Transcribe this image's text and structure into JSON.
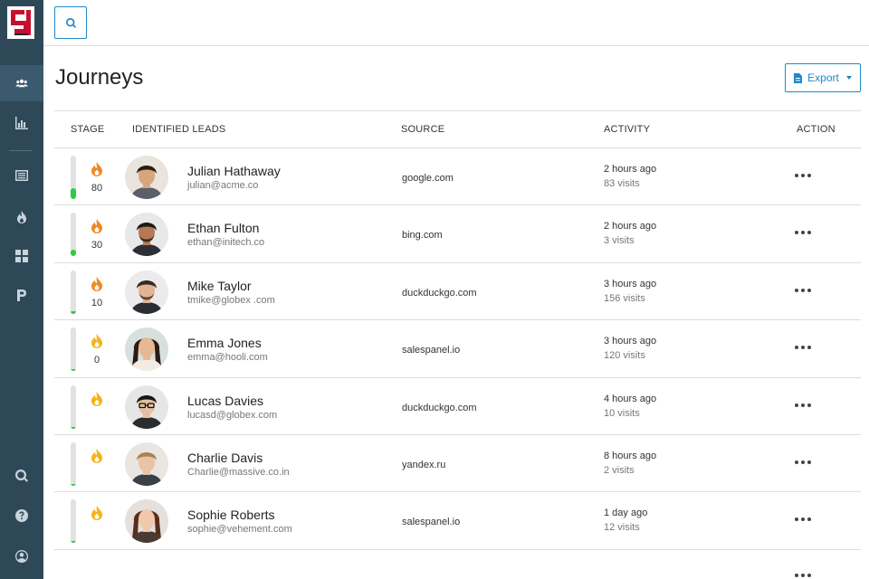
{
  "app": {
    "logo": "salespanel-logo",
    "accent": "#1e88c8",
    "sidebar_bg": "#2f4858"
  },
  "sidebar": {
    "top_items": [
      {
        "icon": "users-icon",
        "active": true
      },
      {
        "icon": "chart-icon",
        "active": false
      },
      {
        "icon": "list-icon",
        "active": false
      },
      {
        "icon": "fire-icon",
        "active": false
      },
      {
        "icon": "grid-icon",
        "active": false
      },
      {
        "icon": "p-icon",
        "active": false
      }
    ],
    "bottom_items": [
      {
        "icon": "search-icon"
      },
      {
        "icon": "help-icon"
      },
      {
        "icon": "account-icon"
      }
    ]
  },
  "topbar": {
    "search_icon": "search-icon"
  },
  "page": {
    "title": "Journeys",
    "export_label": "Export",
    "export_icon": "file-icon"
  },
  "table": {
    "columns": [
      "STAGE",
      "IDENTIFIED LEADS",
      "SOURCE",
      "ACTIVITY",
      "ACTION"
    ],
    "rows": [
      {
        "score": "80",
        "stage_fill": 0.25,
        "flame_color": "#f08a24",
        "name": "Julian Hathaway",
        "email": "julian@acme.co",
        "source": "google.com",
        "time": "2 hours ago",
        "visits": "83 visits",
        "avatar_bg": "#e9e4dc"
      },
      {
        "score": "30",
        "stage_fill": 0.15,
        "flame_color": "#f08a24",
        "name": "Ethan Fulton",
        "email": "ethan@initech.co",
        "source": "bing.com",
        "time": "2 hours ago",
        "visits": "3 visits",
        "avatar_bg": "#e8e8e8"
      },
      {
        "score": "10",
        "stage_fill": 0.06,
        "flame_color": "#f08a24",
        "name": "Mike Taylor",
        "email": "tmike@globex .com",
        "source": "duckduckgo.com",
        "time": "3 hours ago",
        "visits": "156 visits",
        "avatar_bg": "#ebebeb"
      },
      {
        "score": "0",
        "stage_fill": 0.04,
        "flame_color": "#f4b41a",
        "name": "Emma Jones",
        "email": "emma@hooli.com",
        "source": "salespanel.io",
        "time": "3 hours ago",
        "visits": "120 visits",
        "avatar_bg": "#d8e0de"
      },
      {
        "score": "",
        "stage_fill": 0.04,
        "flame_color": "#f4b41a",
        "name": "Lucas Davies",
        "email": "lucasd@globex.com",
        "source": "duckduckgo.com",
        "time": "4 hours ago",
        "visits": "10 visits",
        "avatar_bg": "#e6e6e6"
      },
      {
        "score": "",
        "stage_fill": 0.04,
        "flame_color": "#f4b41a",
        "name": "Charlie Davis",
        "email": "Charlie@massive.co.in",
        "source": "yandex.ru",
        "time": "8 hours ago",
        "visits": "2 visits",
        "avatar_bg": "#e9e6e2"
      },
      {
        "score": "",
        "stage_fill": 0.04,
        "flame_color": "#f4b41a",
        "name": "Sophie Roberts",
        "email": "sophie@vehement.com",
        "source": "salespanel.io",
        "time": "1 day ago",
        "visits": "12 visits",
        "avatar_bg": "#e5e0dc"
      }
    ]
  }
}
